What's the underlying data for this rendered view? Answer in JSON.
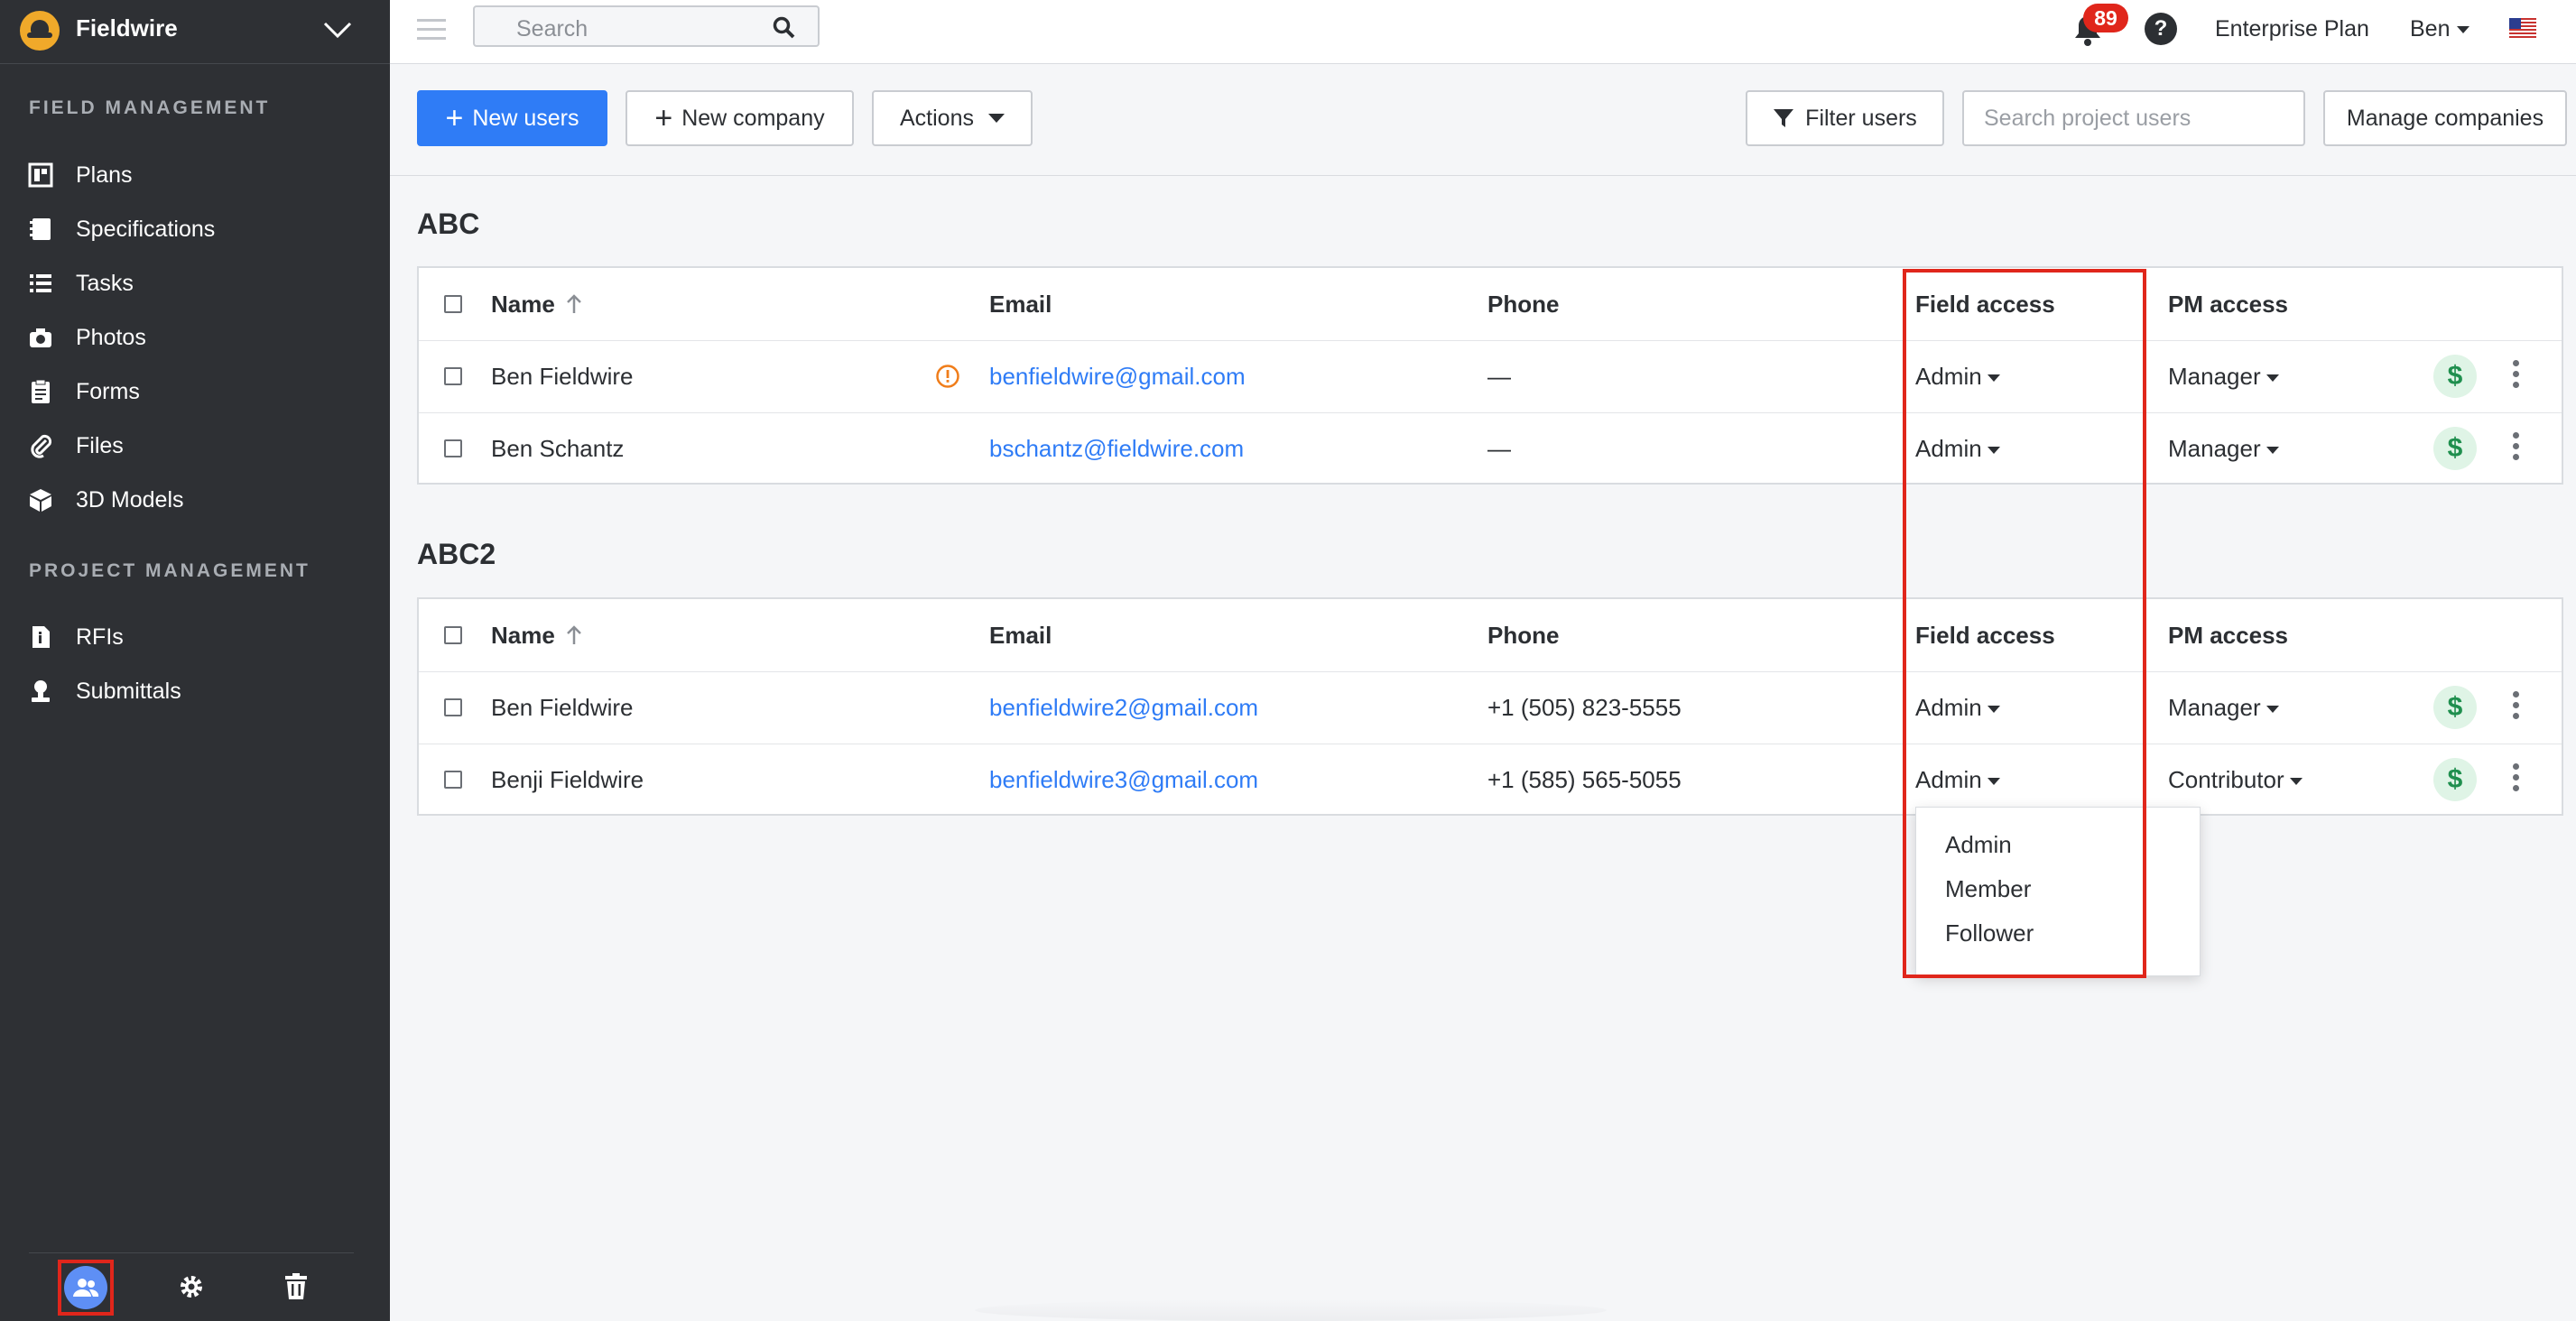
{
  "app": {
    "name": "Fieldwire"
  },
  "sidebar": {
    "section_field": "FIELD MANAGEMENT",
    "field_items": [
      {
        "label": "Plans",
        "icon": "plans-icon"
      },
      {
        "label": "Specifications",
        "icon": "specifications-icon"
      },
      {
        "label": "Tasks",
        "icon": "tasks-icon"
      },
      {
        "label": "Photos",
        "icon": "camera-icon"
      },
      {
        "label": "Forms",
        "icon": "forms-icon"
      },
      {
        "label": "Files",
        "icon": "paperclip-icon"
      },
      {
        "label": "3D Models",
        "icon": "cube-icon"
      }
    ],
    "section_project": "PROJECT MANAGEMENT",
    "project_items": [
      {
        "label": "RFIs",
        "icon": "rfi-icon"
      },
      {
        "label": "Submittals",
        "icon": "submittals-icon"
      }
    ],
    "footer_icons": [
      "users-icon",
      "gear-icon",
      "trash-icon"
    ]
  },
  "topbar": {
    "search_placeholder": "Search",
    "notification_count": "89",
    "help_label": "?",
    "plan": "Enterprise Plan",
    "user": "Ben"
  },
  "toolbar": {
    "new_users": "New users",
    "new_company": "New company",
    "actions": "Actions",
    "filter_users": "Filter users",
    "search_users_placeholder": "Search project users",
    "manage_companies": "Manage companies"
  },
  "columns": {
    "name": "Name",
    "email": "Email",
    "phone": "Phone",
    "field_access": "Field access",
    "pm_access": "PM access"
  },
  "groups": [
    {
      "title": "ABC",
      "rows": [
        {
          "name": "Ben Fieldwire",
          "email": "benfieldwire@gmail.com",
          "phone": "—",
          "field": "Admin",
          "pm": "Manager",
          "warning": true
        },
        {
          "name": "Ben Schantz",
          "email": "bschantz@fieldwire.com",
          "phone": "—",
          "field": "Admin",
          "pm": "Manager",
          "warning": false
        }
      ]
    },
    {
      "title": "ABC2",
      "rows": [
        {
          "name": "Ben Fieldwire",
          "email": "benfieldwire2@gmail.com",
          "phone": "+1 (505) 823-5555",
          "field": "Admin",
          "pm": "Manager",
          "warning": false
        },
        {
          "name": "Benji Fieldwire",
          "email": "benfieldwire3@gmail.com",
          "phone": "+1 (585) 565-5055",
          "field": "Admin",
          "pm": "Contributor",
          "warning": false
        }
      ]
    }
  ],
  "field_access_options": [
    "Admin",
    "Member",
    "Follower"
  ],
  "colors": {
    "primary": "#2f7cf6",
    "sidebar": "#2e3034",
    "highlight": "#e0261b",
    "badge": "#e0261b",
    "dollar": "#1f8f4e"
  }
}
